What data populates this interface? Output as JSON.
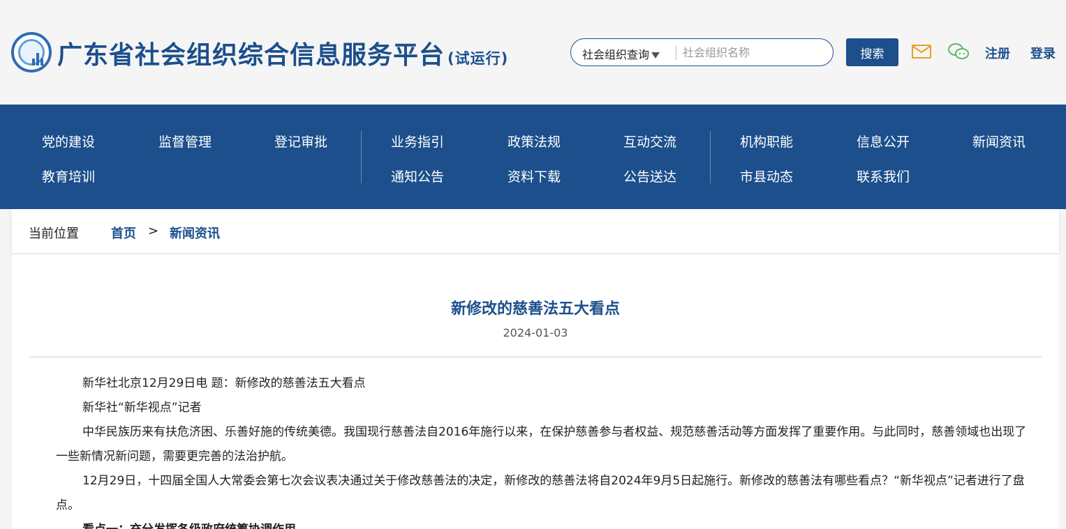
{
  "header": {
    "site_title": "广东省社会组织综合信息服务平台",
    "site_subtitle": "(试运行)",
    "search": {
      "type_selected": "社会组织查询",
      "placeholder": "社会组织名称",
      "button_label": "搜索"
    },
    "register_label": "注册",
    "login_label": "登录",
    "icons": [
      "logo-emblem",
      "mail-icon",
      "wechat-icon"
    ],
    "colors": {
      "primary": "#1c4f8c",
      "mail": "#e8a21c",
      "wechat": "#5cb85c"
    }
  },
  "nav": {
    "items": [
      "党的建设",
      "监督管理",
      "登记审批",
      "业务指引",
      "政策法规",
      "互动交流",
      "机构职能",
      "信息公开",
      "新闻资讯",
      "教育培训",
      "通知公告",
      "资料下载",
      "公告送达",
      "市县动态",
      "联系我们"
    ]
  },
  "breadcrumb": {
    "label": "当前位置",
    "home": "首页",
    "separator": ">",
    "current": "新闻资讯"
  },
  "article": {
    "title": "新修改的慈善法五大看点",
    "date": "2024-01-03",
    "paragraphs": [
      "新华社北京12月29日电 题：新修改的慈善法五大看点",
      "新华社“新华视点”记者",
      "中华民族历来有扶危济困、乐善好施的传统美德。我国现行慈善法自2016年施行以来，在保护慈善参与者权益、规范慈善活动等方面发挥了重要作用。与此同时，慈善领域也出现了一些新情况新问题，需要更完善的法治护航。",
      "12月29日，十四届全国人大常委会第七次会议表决通过关于修改慈善法的决定，新修改的慈善法将自2024年9月5日起施行。新修改的慈善法有哪些看点？“新华视点”记者进行了盘点。",
      "看点一：充分发挥各级政府统筹协调作用"
    ]
  }
}
